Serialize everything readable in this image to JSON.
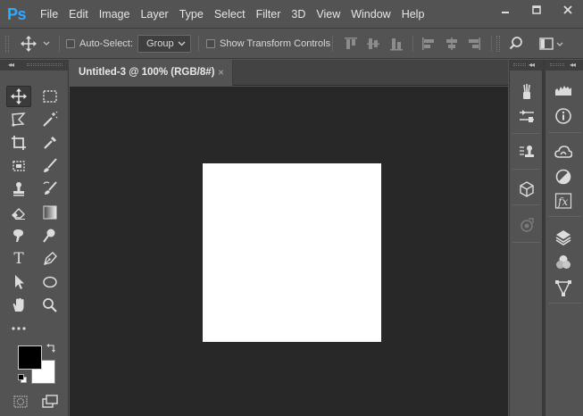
{
  "app": {
    "logo": "Ps"
  },
  "menu": [
    "File",
    "Edit",
    "Image",
    "Layer",
    "Type",
    "Select",
    "Filter",
    "3D",
    "View",
    "Window",
    "Help"
  ],
  "window_controls": [
    "minimize-icon",
    "restore-icon",
    "close-icon"
  ],
  "options": {
    "auto_select_label": "Auto-Select:",
    "auto_select_checked": false,
    "auto_select_target": "Group",
    "show_transform_label": "Show Transform Controls",
    "show_transform_checked": false
  },
  "document_tab": {
    "title": "Untitled-3 @ 100% (RGB/8#)",
    "close": "×"
  },
  "toolbar": {
    "type_tool_glyph": "T",
    "foreground_color": "#000000",
    "background_color": "#ffffff"
  },
  "canvas": {
    "background": "#282828",
    "document_color": "#ffffff"
  },
  "panels_dock1": [
    "brush-icon",
    "brush-settings-icon",
    "clone-source-icon",
    "3d-icon",
    "adjustments-disabled-icon"
  ],
  "panels_dock2": [
    "histogram-icon",
    "info-icon",
    "libraries-icon",
    "adjustments-icon",
    "styles-fx-icon",
    "layers-icon",
    "channels-icon",
    "paths-icon"
  ],
  "colors": {
    "accent": "#31a8ff",
    "ui_bg": "#535353",
    "canvas_bg": "#282828"
  }
}
